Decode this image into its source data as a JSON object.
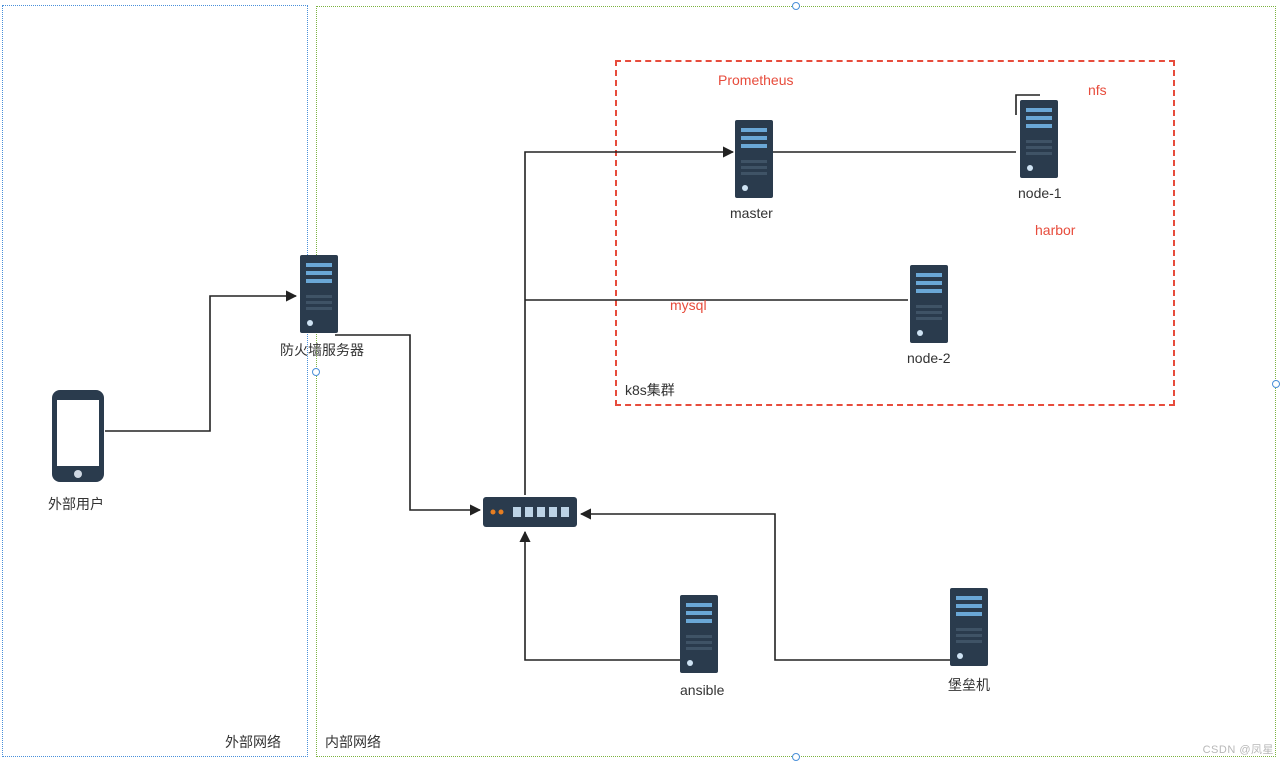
{
  "zones": {
    "external_title": "外部网络",
    "internal_title": "内部网络",
    "k8s_title": "k8s集群"
  },
  "nodes": {
    "external_user": "外部用户",
    "firewall": "防火墙服务器",
    "master": "master",
    "node1": "node-1",
    "node2": "node-2",
    "ansible": "ansible",
    "bastion": "堡垒机"
  },
  "annotations": {
    "prometheus": "Prometheus",
    "nfs": "nfs",
    "mysql": "mysql",
    "harbor": "harbor"
  },
  "watermark": "CSDN @凤星"
}
